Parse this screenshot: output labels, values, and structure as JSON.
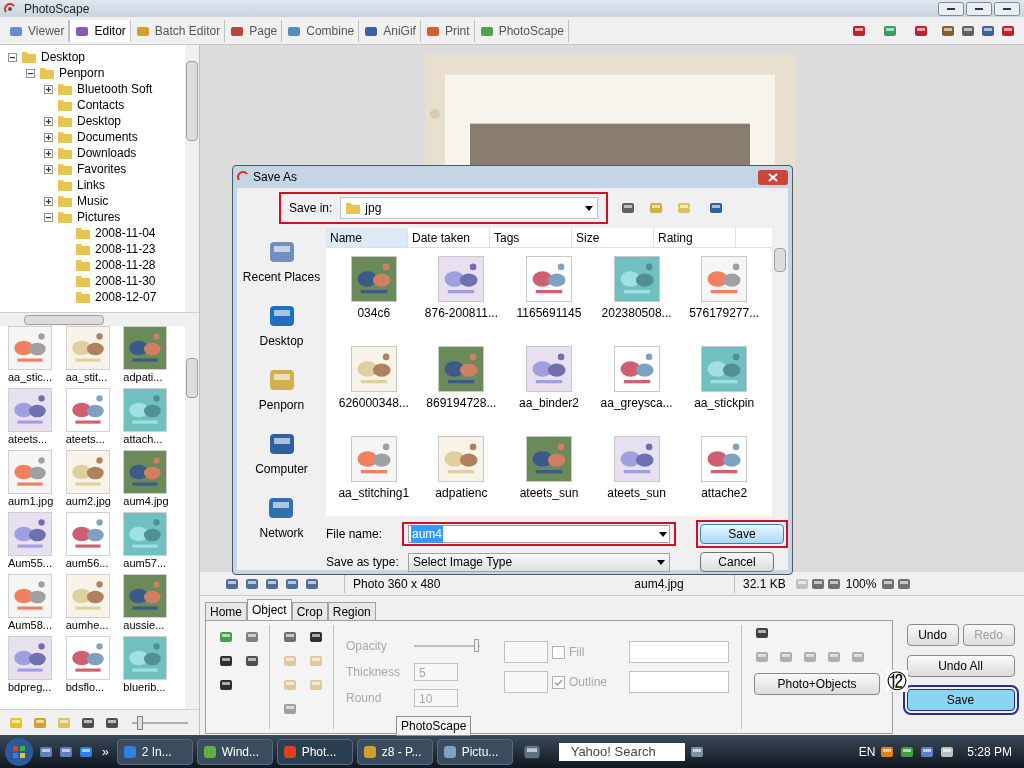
{
  "window": {
    "title": "PhotoScape"
  },
  "modes": [
    {
      "label": "Viewer",
      "selected": false
    },
    {
      "label": "Editor",
      "selected": true
    },
    {
      "label": "Batch Editor",
      "selected": false
    },
    {
      "label": "Page",
      "selected": false
    },
    {
      "label": "Combine",
      "selected": false
    },
    {
      "label": "AniGif",
      "selected": false
    },
    {
      "label": "Print",
      "selected": false
    },
    {
      "label": "PhotoScape",
      "selected": false
    }
  ],
  "tree": [
    {
      "label": "Desktop",
      "expanded": true,
      "children": [
        {
          "label": "Penporn",
          "expanded": true,
          "children": [
            {
              "label": "Bluetooth Soft",
              "expanded": false
            },
            {
              "label": "Contacts"
            },
            {
              "label": "Desktop",
              "expanded": false
            },
            {
              "label": "Documents",
              "expanded": false
            },
            {
              "label": "Downloads",
              "expanded": false
            },
            {
              "label": "Favorites",
              "expanded": false
            },
            {
              "label": "Links"
            },
            {
              "label": "Music",
              "expanded": false
            },
            {
              "label": "Pictures",
              "expanded": true,
              "children": [
                {
                  "label": "2008-11-04"
                },
                {
                  "label": "2008-11-23"
                },
                {
                  "label": "2008-11-28"
                },
                {
                  "label": "2008-11-30"
                },
                {
                  "label": "2008-12-07"
                }
              ]
            }
          ]
        }
      ]
    }
  ],
  "thumbnails": [
    "aa_stic...",
    "aa_stit...",
    "adpati...",
    "ateets...",
    "ateets...",
    "attach...",
    "aum1.jpg",
    "aum2.jpg",
    "aum4.jpg",
    "Aum55...",
    "aum56...",
    "aum57...",
    "Aum58...",
    "aumhe...",
    "aussie...",
    "bdpreg...",
    "bdsflo...",
    "bluerib..."
  ],
  "zoom_slider": {
    "level": 0.1
  },
  "status": {
    "photo": "Photo 360 x 480",
    "file": "aum4.jpg",
    "size": "32.1 KB",
    "zoom": "100%"
  },
  "editor_tabs": [
    {
      "label": "Home",
      "selected": false
    },
    {
      "label": "Object",
      "selected": true
    },
    {
      "label": "Crop",
      "selected": false
    },
    {
      "label": "Region",
      "selected": false
    }
  ],
  "object_panel": {
    "opacity": {
      "label": "Opacity",
      "level": 1.0
    },
    "thickness": {
      "label": "Thickness",
      "value": "5"
    },
    "round": {
      "label": "Round",
      "value": "10"
    },
    "fill": {
      "label": "Fill",
      "checked": false
    },
    "outline": {
      "label": "Outline",
      "checked": true
    },
    "disabled": true,
    "photo_objects": "Photo+Objects"
  },
  "tooltip": "PhotoScape",
  "actions": [
    {
      "label": "Undo",
      "disabled": false,
      "highlighted": false
    },
    {
      "label": "Redo",
      "disabled": true,
      "highlighted": false
    },
    {
      "label": "Undo All",
      "disabled": false,
      "highlighted": false
    },
    {
      "label": "Save",
      "disabled": false,
      "highlighted": true
    }
  ],
  "step_marker": "⑫",
  "dialog": {
    "title": "Save As",
    "save_in": {
      "label": "Save in:",
      "value": "jpg",
      "highlighted": true
    },
    "places": [
      "Recent Places",
      "Desktop",
      "Penporn",
      "Computer",
      "Network"
    ],
    "columns": [
      {
        "label": "Name",
        "selected": true
      },
      {
        "label": "Date taken",
        "selected": false
      },
      {
        "label": "Tags",
        "selected": false
      },
      {
        "label": "Size",
        "selected": false
      },
      {
        "label": "Rating",
        "selected": false
      }
    ],
    "files": [
      "034c6",
      "876-200811...",
      "1165691145",
      "202380508...",
      "576179277...",
      "626000348...",
      "869194728...",
      "aa_binder2",
      "aa_greysca...",
      "aa_stickpin",
      "aa_stitching1",
      "adpatienc",
      "ateets_sun",
      "ateets_sun",
      "attache2"
    ],
    "file_name": {
      "label": "File name:",
      "value": "aum4",
      "highlighted": true
    },
    "save_as_type": {
      "label": "Save as type:",
      "value": "Select Image Type"
    },
    "buttons": [
      {
        "label": "Save",
        "highlighted": true
      },
      {
        "label": "Cancel",
        "highlighted": false
      }
    ]
  },
  "taskbar": {
    "overflow": "»",
    "items": [
      {
        "label": "2 In...",
        "selected": false
      },
      {
        "label": "Wind...",
        "selected": false
      },
      {
        "label": "Phot...",
        "selected": true
      },
      {
        "label": "z8 - P...",
        "selected": false
      },
      {
        "label": "Pictu...",
        "selected": false
      }
    ],
    "search": {
      "placeholder": "Yahoo! Search"
    },
    "language": "EN",
    "time": "5:28 PM"
  }
}
